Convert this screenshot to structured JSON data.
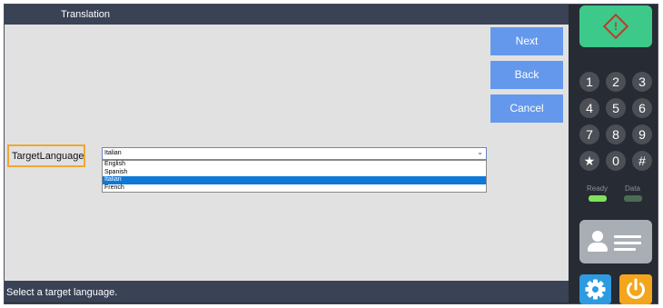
{
  "window": {
    "title": "Translation"
  },
  "buttons": {
    "next": "Next",
    "back": "Back",
    "cancel": "Cancel"
  },
  "language": {
    "label": "TargetLanguage:",
    "selected": "Italian",
    "options": [
      "English",
      "Spanish",
      "Italian",
      "French"
    ],
    "selected_index": 2
  },
  "status": {
    "message": "Select a target language."
  },
  "panel": {
    "start_icon": "warning-diamond-icon",
    "keypad": [
      "1",
      "2",
      "3",
      "4",
      "5",
      "6",
      "7",
      "8",
      "9",
      "★",
      "0",
      "#"
    ],
    "indicators": {
      "ready_label": "Ready",
      "data_label": "Data",
      "ready_color": "#7fe35a",
      "data_color": "#4e6b55"
    },
    "id_icon": "id-card-icon",
    "settings_icon": "gear-icon",
    "power_icon": "power-icon"
  },
  "colors": {
    "button": "#6498ec",
    "selection": "#0e78d8",
    "highlight": "#f0a830",
    "start": "#3cc98a",
    "settings": "#2e9be0",
    "power": "#f3a51c"
  }
}
